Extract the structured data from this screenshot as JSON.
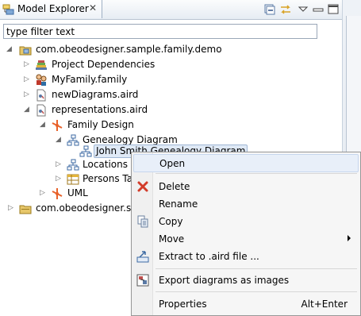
{
  "view": {
    "title": "Model Explorer",
    "close_glyph": "✕",
    "toolbar": [
      "collapse-all-icon",
      "link-with-editor-icon",
      "view-menu-icon",
      "minimize-icon",
      "maximize-icon"
    ]
  },
  "filter": {
    "value": "type filter text"
  },
  "tree": [
    {
      "label": "com.obeodesigner.sample.family.demo",
      "icon": "modeling-project-icon"
    },
    {
      "label": "Project Dependencies",
      "icon": "library-icon"
    },
    {
      "label": "MyFamily.family",
      "icon": "family-model-icon"
    },
    {
      "label": "newDiagrams.aird",
      "icon": "aird-file-icon"
    },
    {
      "label": "representations.aird",
      "icon": "aird-file-icon"
    },
    {
      "label": "Family Design",
      "icon": "viewpoint-icon"
    },
    {
      "label": "Genealogy Diagram",
      "icon": "diagram-description-icon"
    },
    {
      "label": "John Smith Genealogy Diagram",
      "icon": "diagram-icon"
    },
    {
      "label": "Locations D",
      "icon": "diagram-description-icon"
    },
    {
      "label": "Persons Tab",
      "icon": "table-icon"
    },
    {
      "label": "UML",
      "icon": "viewpoint-icon"
    },
    {
      "label": "com.obeodesigner.sam",
      "icon": "folder-project-icon"
    }
  ],
  "context_menu": {
    "open": "Open",
    "delete": "Delete",
    "rename": "Rename",
    "copy": "Copy",
    "move": "Move",
    "extract": "Extract to .aird file ...",
    "export": "Export diagrams as images",
    "properties": "Properties",
    "properties_shortcut": "Alt+Enter"
  },
  "colors": {
    "selection": "#dfe9f6",
    "menu_highlight": "#e8eff9",
    "delete_red": "#d23c2a",
    "viewpoint_orange": "#e8622a"
  }
}
